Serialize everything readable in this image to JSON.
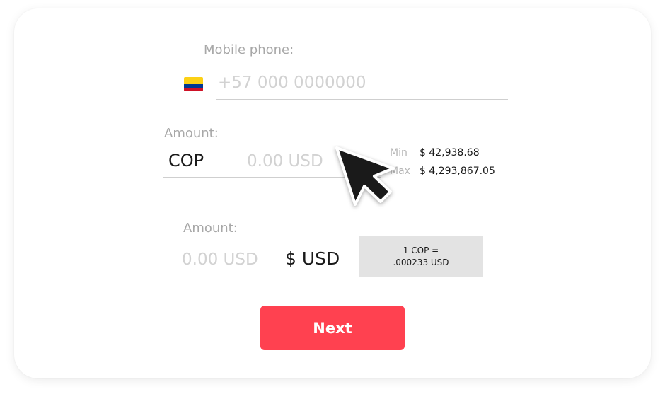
{
  "phone": {
    "label": "Mobile phone:",
    "placeholder": "+57 000 0000000",
    "flag_icon": "colombia-flag-icon",
    "flag_colors": [
      "#fcd116",
      "#003893",
      "#ce1126"
    ]
  },
  "amount_from": {
    "label": "Amount:",
    "currency": "COP",
    "placeholder": "0.00 USD"
  },
  "limits": {
    "min_label": "Min",
    "min_value": "$ 42,938.68",
    "max_label": "Max",
    "max_value": "$ 4,293,867.05"
  },
  "amount_to": {
    "label": "Amount:",
    "placeholder": "0.00 USD",
    "currency": "$ USD"
  },
  "rate": {
    "line1": "1 COP =",
    "line2": ".000233 USD"
  },
  "actions": {
    "next_label": "Next",
    "accent_color": "#ff4150"
  },
  "cursor_icon": "arrow-cursor-icon"
}
